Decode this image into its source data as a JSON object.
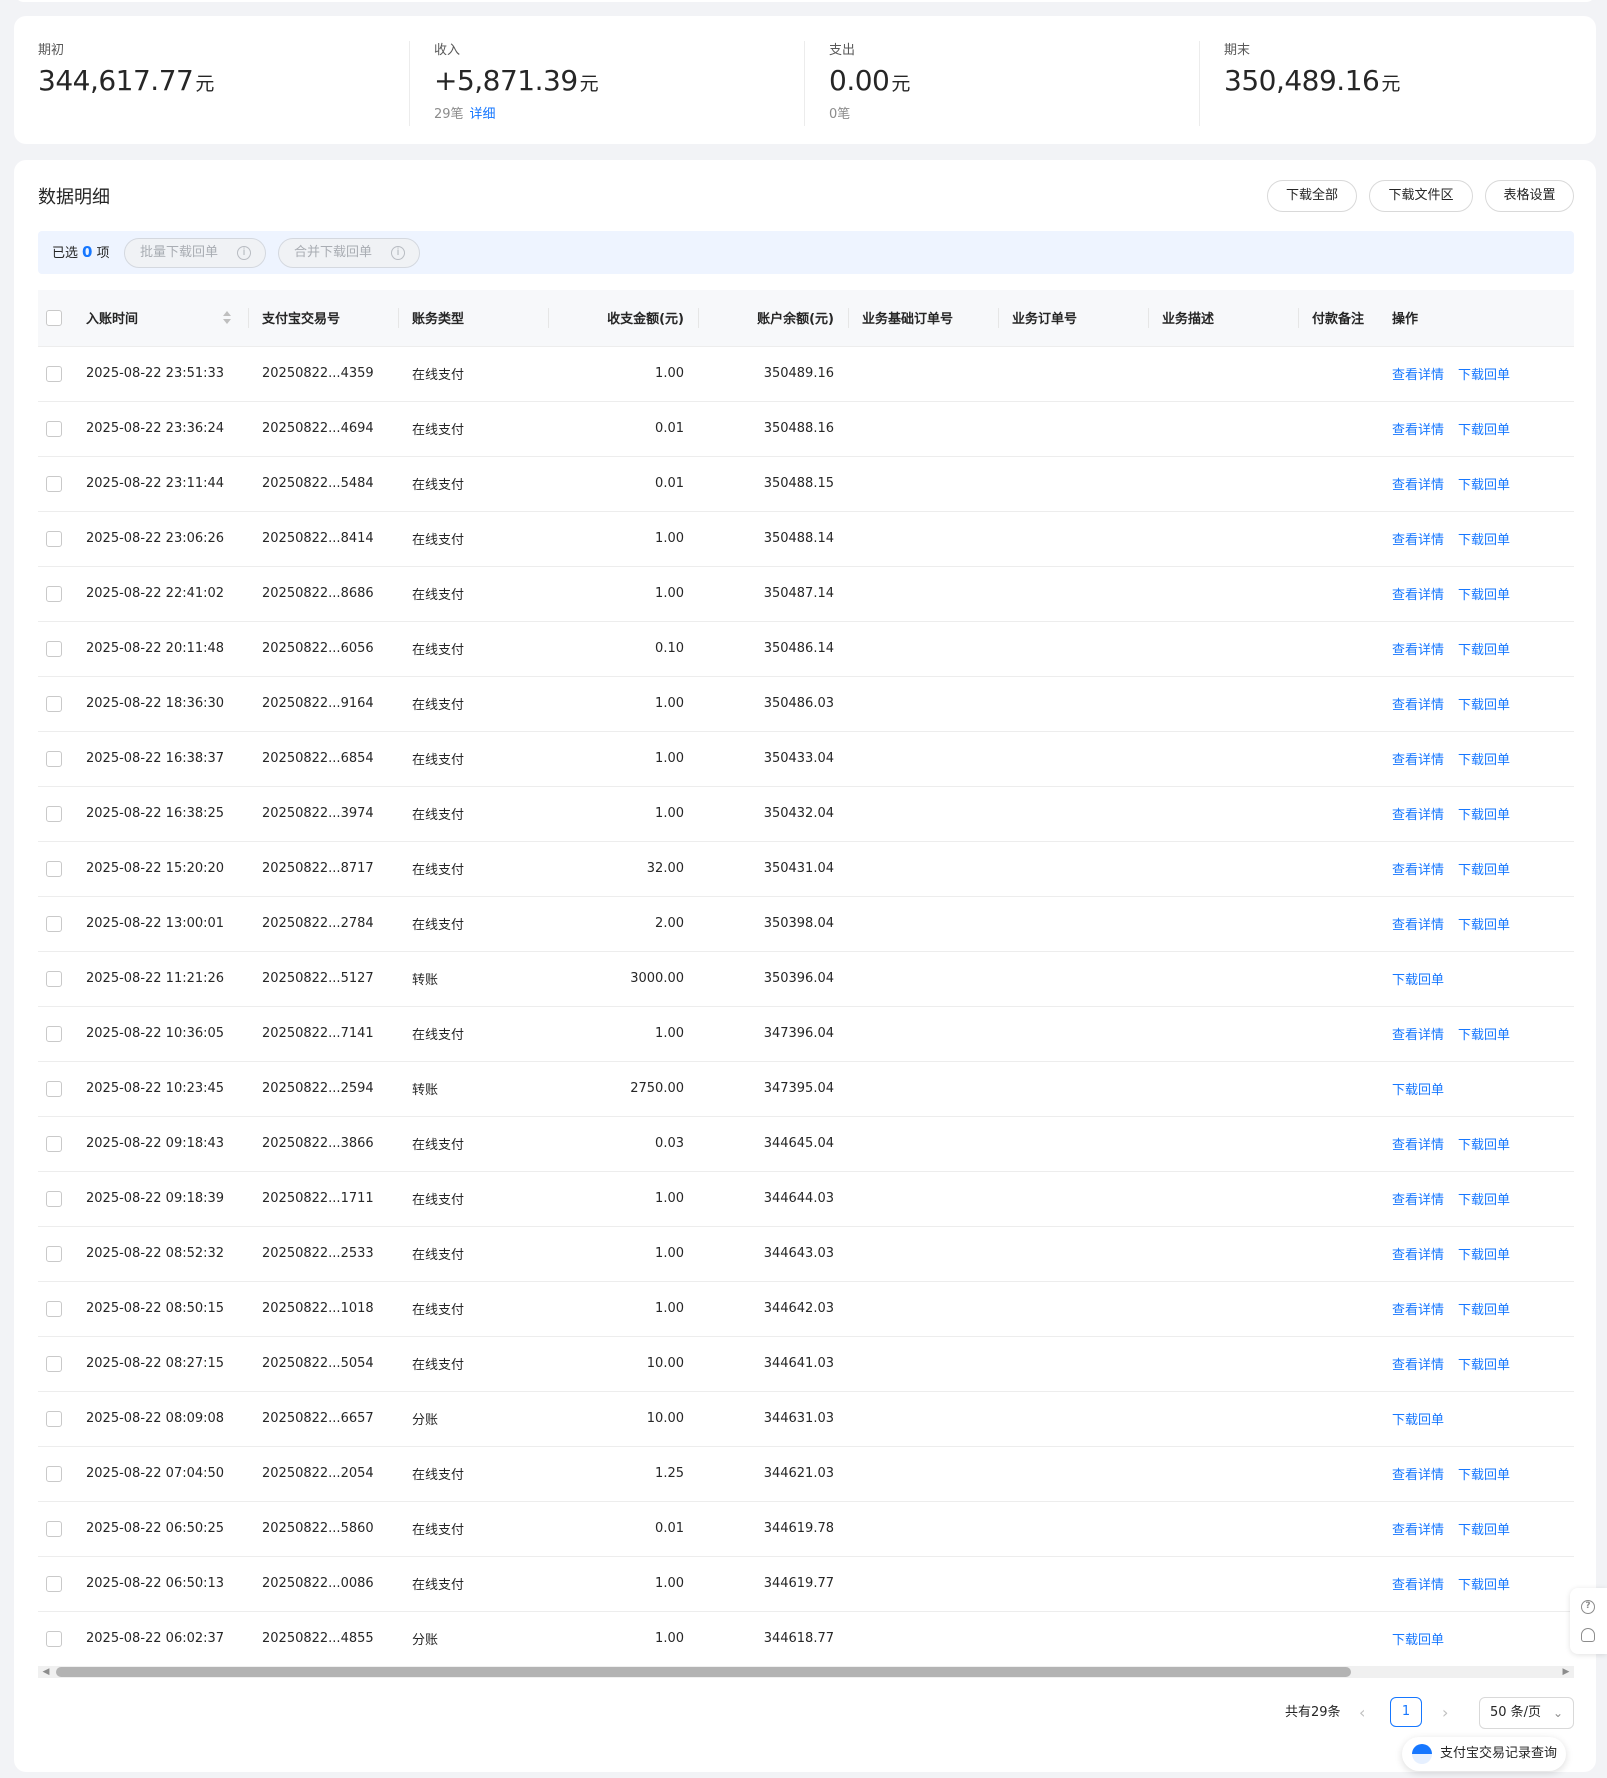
{
  "summary": {
    "opening": {
      "label": "期初",
      "value": "344,617.77",
      "unit": "元"
    },
    "income": {
      "label": "收入",
      "value": "+5,871.39",
      "unit": "元",
      "count": "29笔",
      "link": "详细"
    },
    "expense": {
      "label": "支出",
      "value": "0.00",
      "unit": "元",
      "count": "0笔"
    },
    "closing": {
      "label": "期末",
      "value": "350,489.16",
      "unit": "元"
    }
  },
  "detail": {
    "title": "数据明细",
    "buttons": {
      "download_all": "下载全部",
      "download_area": "下载文件区",
      "table_settings": "表格设置"
    },
    "selection": {
      "prefix": "已选",
      "count": "0",
      "suffix": "项",
      "batch_download": "批量下载回单",
      "merge_download": "合并下载回单"
    }
  },
  "table": {
    "columns": {
      "time": "入账时间",
      "trade_no": "支付宝交易号",
      "type": "账务类型",
      "amount": "收支金额(元)",
      "balance": "账户余额(元)",
      "base_order": "业务基础订单号",
      "order": "业务订单号",
      "desc": "业务描述",
      "payer": "付款备注",
      "ops": "操作"
    },
    "link_detail": "查看详情",
    "link_receipt": "下载回单",
    "rows": [
      {
        "time": "2025-08-22 23:51:33",
        "trade_no": "20250822...4359",
        "type": "在线支付",
        "amount": "1.00",
        "balance": "350489.16",
        "op1": "查看详情",
        "op2": "下载回单"
      },
      {
        "time": "2025-08-22 23:36:24",
        "trade_no": "20250822...4694",
        "type": "在线支付",
        "amount": "0.01",
        "balance": "350488.16",
        "op1": "查看详情",
        "op2": "下载回单"
      },
      {
        "time": "2025-08-22 23:11:44",
        "trade_no": "20250822...5484",
        "type": "在线支付",
        "amount": "0.01",
        "balance": "350488.15",
        "op1": "查看详情",
        "op2": "下载回单"
      },
      {
        "time": "2025-08-22 23:06:26",
        "trade_no": "20250822...8414",
        "type": "在线支付",
        "amount": "1.00",
        "balance": "350488.14",
        "op1": "查看详情",
        "op2": "下载回单"
      },
      {
        "time": "2025-08-22 22:41:02",
        "trade_no": "20250822...8686",
        "type": "在线支付",
        "amount": "1.00",
        "balance": "350487.14",
        "op1": "查看详情",
        "op2": "下载回单"
      },
      {
        "time": "2025-08-22 20:11:48",
        "trade_no": "20250822...6056",
        "type": "在线支付",
        "amount": "0.10",
        "balance": "350486.14",
        "op1": "查看详情",
        "op2": "下载回单"
      },
      {
        "time": "2025-08-22 18:36:30",
        "trade_no": "20250822...9164",
        "type": "在线支付",
        "amount": "1.00",
        "balance": "350486.03",
        "op1": "查看详情",
        "op2": "下载回单"
      },
      {
        "time": "2025-08-22 16:38:37",
        "trade_no": "20250822...6854",
        "type": "在线支付",
        "amount": "1.00",
        "balance": "350433.04",
        "op1": "查看详情",
        "op2": "下载回单"
      },
      {
        "time": "2025-08-22 16:38:25",
        "trade_no": "20250822...3974",
        "type": "在线支付",
        "amount": "1.00",
        "balance": "350432.04",
        "op1": "查看详情",
        "op2": "下载回单"
      },
      {
        "time": "2025-08-22 15:20:20",
        "trade_no": "20250822...8717",
        "type": "在线支付",
        "amount": "32.00",
        "balance": "350431.04",
        "op1": "查看详情",
        "op2": "下载回单"
      },
      {
        "time": "2025-08-22 13:00:01",
        "trade_no": "20250822...2784",
        "type": "在线支付",
        "amount": "2.00",
        "balance": "350398.04",
        "op1": "查看详情",
        "op2": "下载回单"
      },
      {
        "time": "2025-08-22 11:21:26",
        "trade_no": "20250822...5127",
        "type": "转账",
        "amount": "3000.00",
        "balance": "350396.04",
        "op1": "下载回单",
        "op2": ""
      },
      {
        "time": "2025-08-22 10:36:05",
        "trade_no": "20250822...7141",
        "type": "在线支付",
        "amount": "1.00",
        "balance": "347396.04",
        "op1": "查看详情",
        "op2": "下载回单"
      },
      {
        "time": "2025-08-22 10:23:45",
        "trade_no": "20250822...2594",
        "type": "转账",
        "amount": "2750.00",
        "balance": "347395.04",
        "op1": "下载回单",
        "op2": ""
      },
      {
        "time": "2025-08-22 09:18:43",
        "trade_no": "20250822...3866",
        "type": "在线支付",
        "amount": "0.03",
        "balance": "344645.04",
        "op1": "查看详情",
        "op2": "下载回单"
      },
      {
        "time": "2025-08-22 09:18:39",
        "trade_no": "20250822...1711",
        "type": "在线支付",
        "amount": "1.00",
        "balance": "344644.03",
        "op1": "查看详情",
        "op2": "下载回单"
      },
      {
        "time": "2025-08-22 08:52:32",
        "trade_no": "20250822...2533",
        "type": "在线支付",
        "amount": "1.00",
        "balance": "344643.03",
        "op1": "查看详情",
        "op2": "下载回单"
      },
      {
        "time": "2025-08-22 08:50:15",
        "trade_no": "20250822...1018",
        "type": "在线支付",
        "amount": "1.00",
        "balance": "344642.03",
        "op1": "查看详情",
        "op2": "下载回单"
      },
      {
        "time": "2025-08-22 08:27:15",
        "trade_no": "20250822...5054",
        "type": "在线支付",
        "amount": "10.00",
        "balance": "344641.03",
        "op1": "查看详情",
        "op2": "下载回单"
      },
      {
        "time": "2025-08-22 08:09:08",
        "trade_no": "20250822...6657",
        "type": "分账",
        "amount": "10.00",
        "balance": "344631.03",
        "op1": "下载回单",
        "op2": ""
      },
      {
        "time": "2025-08-22 07:04:50",
        "trade_no": "20250822...2054",
        "type": "在线支付",
        "amount": "1.25",
        "balance": "344621.03",
        "op1": "查看详情",
        "op2": "下载回单"
      },
      {
        "time": "2025-08-22 06:50:25",
        "trade_no": "20250822...5860",
        "type": "在线支付",
        "amount": "0.01",
        "balance": "344619.78",
        "op1": "查看详情",
        "op2": "下载回单"
      },
      {
        "time": "2025-08-22 06:50:13",
        "trade_no": "20250822...0086",
        "type": "在线支付",
        "amount": "1.00",
        "balance": "344619.77",
        "op1": "查看详情",
        "op2": "下载回单"
      },
      {
        "time": "2025-08-22 06:02:37",
        "trade_no": "20250822...4855",
        "type": "分账",
        "amount": "1.00",
        "balance": "344618.77",
        "op1": "下载回单",
        "op2": ""
      }
    ]
  },
  "pagination": {
    "total": "共有29条",
    "current": "1",
    "page_size": "50 条/页"
  },
  "float_pill": {
    "label": "支付宝交易记录查询"
  },
  "icons": {
    "info": "info-circle-icon",
    "sort": "sort-icon",
    "prev": "chevron-left-icon",
    "next": "chevron-right-icon",
    "help": "question-circle-icon",
    "support": "headset-icon"
  },
  "colors": {
    "accent": "#1677ff",
    "page_bg": "#f2f3f6"
  }
}
